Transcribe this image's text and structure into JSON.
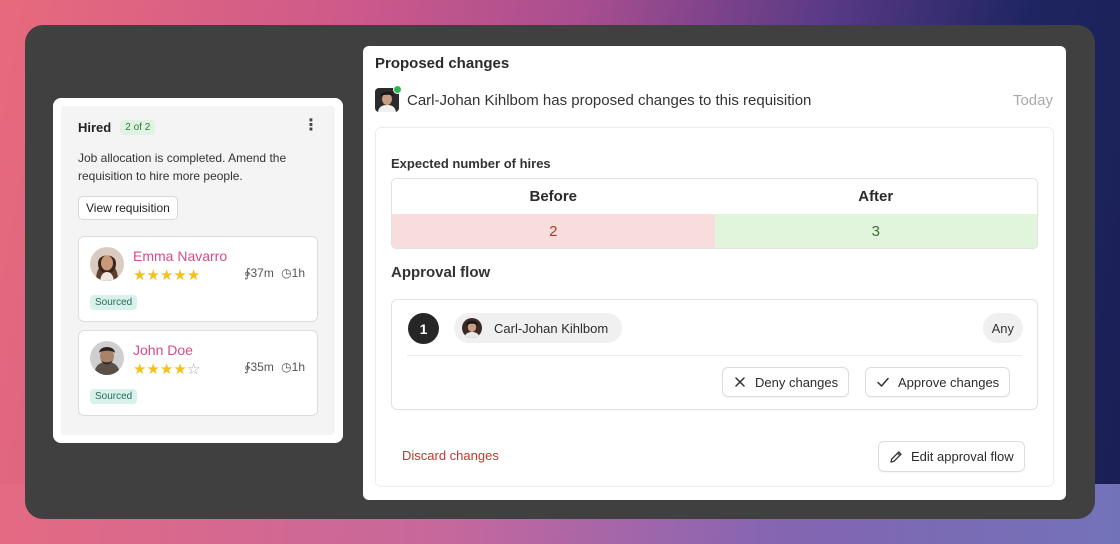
{
  "left_card": {
    "title": "Hired",
    "count_badge": "2 of 2",
    "description": "Job allocation is completed. Amend the requisition to hire more people.",
    "view_button": "View requisition",
    "candidates": [
      {
        "name": "Emma Navarro",
        "rating": 5,
        "max_rating": 5,
        "duration": "37m",
        "time": "1h",
        "tag": "Sourced"
      },
      {
        "name": "John Doe",
        "rating": 4,
        "max_rating": 5,
        "duration": "35m",
        "time": "1h",
        "tag": "Sourced"
      }
    ]
  },
  "panel": {
    "title": "Proposed changes",
    "author_message": "Carl-Johan Kihlbom has proposed changes to this requisition",
    "when": "Today",
    "hires": {
      "label": "Expected number of hires",
      "before_label": "Before",
      "after_label": "After",
      "before_value": "2",
      "after_value": "3"
    },
    "approval": {
      "label": "Approval flow",
      "step_number": "1",
      "approver": "Carl-Johan Kihlbom",
      "scope": "Any",
      "deny_label": "Deny changes",
      "approve_label": "Approve changes"
    },
    "discard_label": "Discard changes",
    "edit_flow_label": "Edit approval flow"
  },
  "colors": {
    "accent_name": "#d64c86",
    "star": "#f2c21b",
    "danger": "#c6352c",
    "online": "#2fb556"
  }
}
